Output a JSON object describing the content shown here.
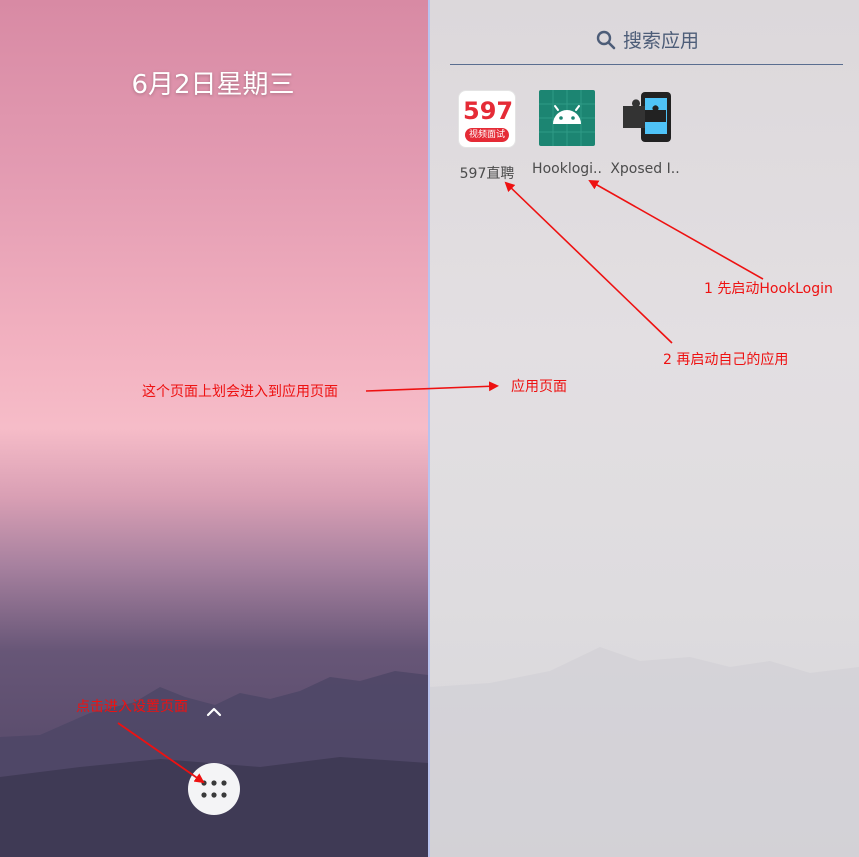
{
  "home": {
    "date": "6月2日星期三"
  },
  "drawer": {
    "search_placeholder": "搜索应用",
    "apps": [
      {
        "label": "597直聘",
        "icon": "597-zhipin-app-icon"
      },
      {
        "label": "Hooklogi..",
        "icon": "android-app-icon"
      },
      {
        "label": "Xposed I..",
        "icon": "xposed-puzzle-app-icon"
      }
    ]
  },
  "app_icon_text": {
    "big": "597",
    "small": "视频面试"
  },
  "annotations": {
    "swipe_up": "这个页面上划会进入到应用页面",
    "app_page": "应用页面",
    "step1": "1 先启动HookLogin",
    "step2": "2 再启动自己的应用",
    "tap_settings": "点击进入设置页面"
  },
  "colors": {
    "annotation": "#ee1111",
    "divider": "#b8c3ef",
    "search_text": "#4d5d78"
  }
}
